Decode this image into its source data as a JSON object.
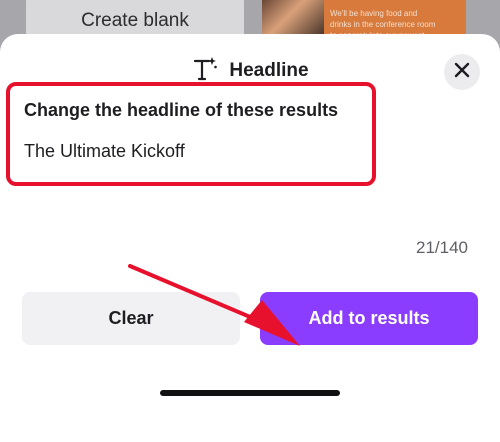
{
  "background": {
    "create_blank_label": "Create blank",
    "promo_lines": [
      "We'll be having food and",
      "drinks in the conference room",
      "to congratulate our newest"
    ]
  },
  "sheet": {
    "title": "Headline",
    "title_icon": "text-sparkle-icon",
    "close_icon": "close-icon"
  },
  "edit": {
    "prompt": "Change the headline of these results",
    "value": "The Ultimate Kickoff",
    "char_count": "21/140"
  },
  "actions": {
    "clear_label": "Clear",
    "add_label": "Add to results"
  },
  "colors": {
    "accent": "#8b3dff",
    "highlight": "#e8112d"
  }
}
